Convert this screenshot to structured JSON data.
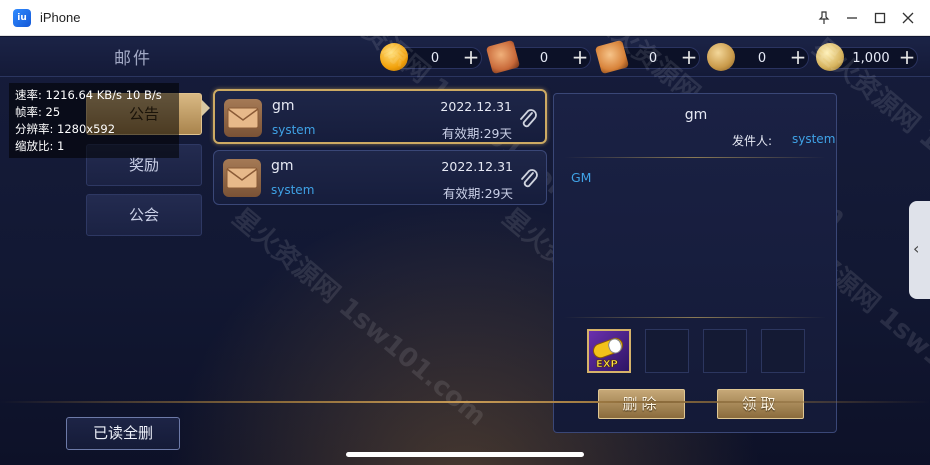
{
  "window": {
    "title": "iPhone",
    "app_icon_text": "iu"
  },
  "window_controls": [
    "pin",
    "minimize",
    "maximize",
    "close"
  ],
  "game": {
    "screen_title": "邮件",
    "currencies": [
      {
        "icon": "gold-coin-icon",
        "amount": "0",
        "color": "#f2a20c"
      },
      {
        "icon": "scroll-icon",
        "amount": "0",
        "color": "#c96a3a"
      },
      {
        "icon": "ticket-icon",
        "amount": "0",
        "color": "#d8833a"
      },
      {
        "icon": "bronze-coin-icon",
        "amount": "0",
        "color": "#c99a4a"
      },
      {
        "icon": "gold-ingot-coin-icon",
        "amount": "1,000",
        "color": "#d6b35e"
      }
    ],
    "stats": {
      "rate": "速率: 1216.64 KB/s  10 B/s",
      "fps": "帧率: 25",
      "resolution": "分辨率: 1280x592",
      "scale": "缩放比: 1"
    },
    "tabs": [
      {
        "label": "公告",
        "active": true
      },
      {
        "label": "奖励",
        "active": false
      },
      {
        "label": "公会",
        "active": false
      }
    ],
    "mails": [
      {
        "sender": "gm",
        "subtitle": "system",
        "date": "2022.12.31",
        "expiry": "有效期:29天",
        "selected": true
      },
      {
        "sender": "gm",
        "subtitle": "system",
        "date": "2022.12.31",
        "expiry": "有效期:29天",
        "selected": false
      }
    ],
    "detail": {
      "title": "gm",
      "sender_label": "发件人:",
      "sender": "system",
      "body": "GM",
      "attachment_badge": "EXP",
      "delete_label": "删除",
      "claim_label": "领取"
    },
    "read_all_label": "已读全删",
    "watermark": "星火资源网 1sw101.com"
  }
}
